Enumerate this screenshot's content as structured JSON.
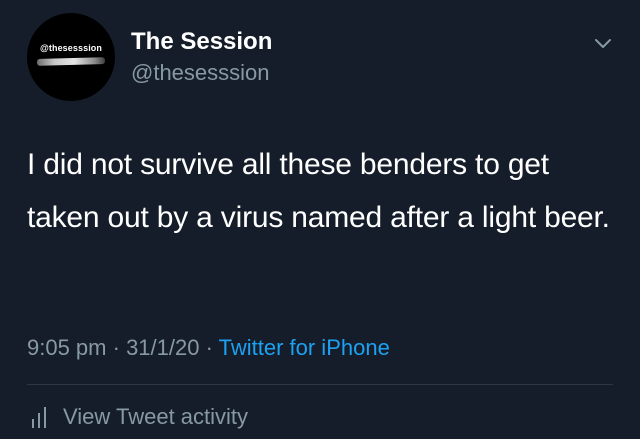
{
  "user": {
    "avatar_text": "@thesesssion",
    "display_name": "The Session",
    "handle": "@thesesssion"
  },
  "tweet": {
    "text": "I did not survive all these benders to get taken out by a virus named after a light beer.",
    "time": "9:05 pm",
    "separator_1": " · ",
    "date": "31/1/20",
    "separator_2": " · ",
    "source": "Twitter for iPhone"
  },
  "actions": {
    "activity_label": "View Tweet activity"
  },
  "icons": {
    "menu": "chevron-down-icon",
    "activity": "bar-chart-icon"
  },
  "colors": {
    "background": "#141d29",
    "text_primary": "#ffffff",
    "text_secondary": "#8899a6",
    "link": "#1da1f2"
  }
}
